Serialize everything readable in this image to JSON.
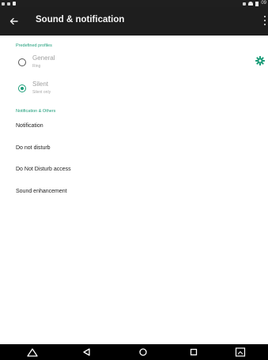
{
  "status_bar": {
    "time": "09"
  },
  "toolbar": {
    "back_icon": "arrow-back-icon",
    "title": "Sound & notification",
    "overflow_icon": "more-vert-icon"
  },
  "colors": {
    "accent": "#1c9d79",
    "toolbar_bg": "#1e1e1e",
    "status_bar_bg": "#1f1f1f",
    "nav_bar_bg": "#000000",
    "page_bg": "#ffffff"
  },
  "predefined_profiles": {
    "header": "Predefined profiles",
    "items": [
      {
        "title": "General",
        "subtitle": "Ring",
        "checked": false
      },
      {
        "title": "Silent",
        "subtitle": "Silent only",
        "checked": true
      }
    ],
    "settings_icon": "gear-icon"
  },
  "notification_others": {
    "header": "Notification & Others",
    "items": [
      {
        "label": "Notification"
      },
      {
        "label": "Do not disturb"
      },
      {
        "label": "Do Not Disturb access"
      },
      {
        "label": "Sound enhancement"
      }
    ]
  },
  "nav_bar": {
    "buttons": [
      "triangle-up-icon",
      "back-triangle-icon",
      "home-circle-icon",
      "recents-square-icon",
      "screenshot-icon"
    ]
  }
}
